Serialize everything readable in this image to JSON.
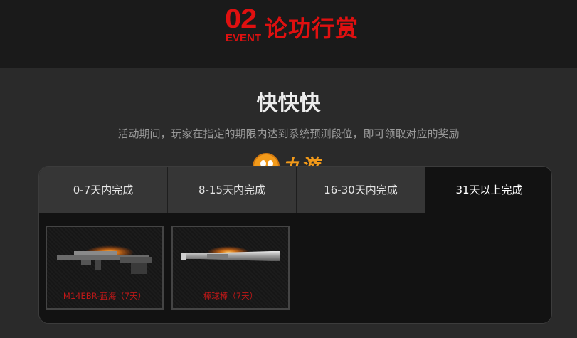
{
  "event": {
    "logo_number": "02",
    "logo_word": "EVENT",
    "title": "论功行赏"
  },
  "section": {
    "heading": "快快快",
    "description": "活动期间，玩家在指定的期限内达到系统预测段位，即可领取对应的奖励"
  },
  "watermark": {
    "text": "九游"
  },
  "tabs": [
    {
      "label": "0-7天内完成",
      "active": false
    },
    {
      "label": "8-15天内完成",
      "active": false
    },
    {
      "label": "16-30天内完成",
      "active": false
    },
    {
      "label": "31天以上完成",
      "active": true
    }
  ],
  "rewards": [
    {
      "name": "M14EBR-蓝海（7天）",
      "icon": "rifle-icon"
    },
    {
      "name": "棒球棒（7天）",
      "icon": "baseball-bat-icon"
    }
  ],
  "colors": {
    "accent": "#e01010",
    "page_background": "#2a2a2a",
    "banner_background": "#1a1a1a",
    "panel_background": "#121212",
    "tab_background": "#363636",
    "reward_label": "#c01818",
    "watermark": "#f29a1a"
  }
}
